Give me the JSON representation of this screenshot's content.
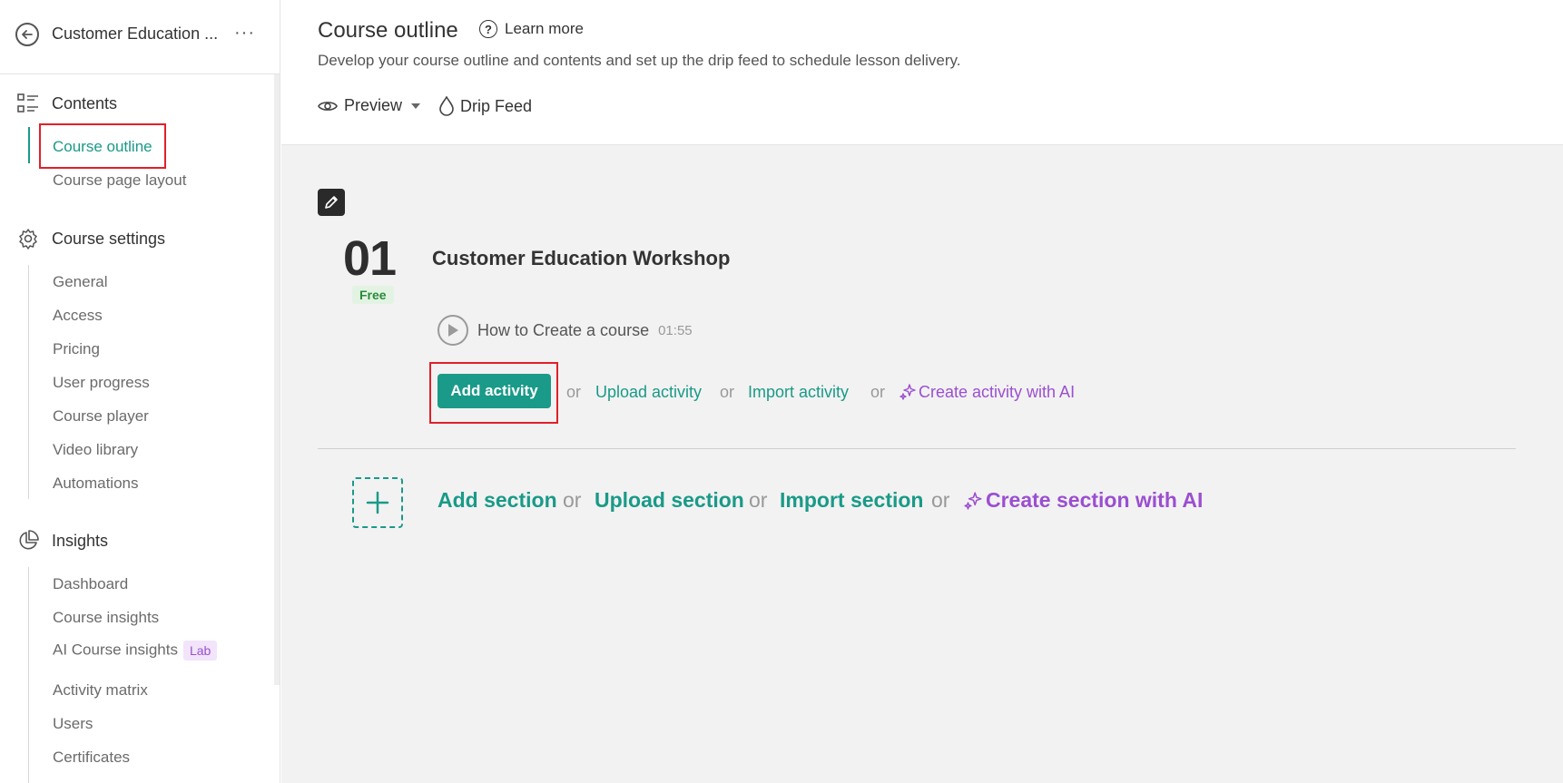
{
  "sidebar": {
    "course_name": "Customer Education ...",
    "more_label": "···",
    "groups": {
      "contents": {
        "label": "Contents",
        "items": [
          "Course outline",
          "Course page layout"
        ]
      },
      "settings": {
        "label": "Course settings",
        "items": [
          "General",
          "Access",
          "Pricing",
          "User progress",
          "Course player",
          "Video library",
          "Automations"
        ]
      },
      "insights": {
        "label": "Insights",
        "items": [
          "Dashboard",
          "Course insights",
          "AI Course insights",
          "Activity matrix",
          "Users",
          "Certificates"
        ],
        "lab_badge": "Lab"
      }
    },
    "active_item": "Course outline"
  },
  "header": {
    "title": "Course outline",
    "learn_more": "Learn more",
    "subtitle": "Develop your course outline and contents and set up the drip feed to schedule lesson delivery.",
    "preview_label": "Preview",
    "drip_feed_label": "Drip Feed"
  },
  "section": {
    "number": "01",
    "badge": "Free",
    "title": "Customer Education Workshop",
    "activity": {
      "title": "How to Create a course",
      "duration": "01:55"
    },
    "add_activity": "Add activity",
    "or": "or",
    "upload_activity": "Upload activity",
    "import_activity": "Import activity",
    "create_activity_ai": "Create activity with AI"
  },
  "add_section": {
    "add": "Add section",
    "or": "or",
    "upload": "Upload section",
    "import": "Import section",
    "create_ai": "Create section with AI"
  },
  "colors": {
    "accent": "#1a9a88",
    "ai": "#9b4fd0",
    "highlight": "#e0202a"
  }
}
